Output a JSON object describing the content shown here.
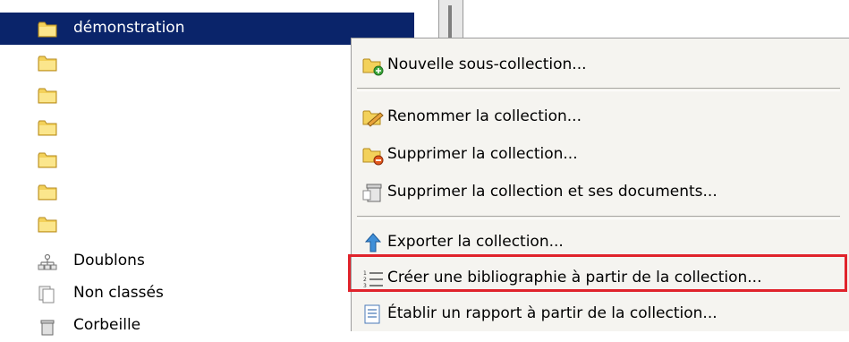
{
  "tree": {
    "selected_label": "démonstration",
    "items": [
      {
        "label": "",
        "icon": "folder-icon"
      },
      {
        "label": "",
        "icon": "folder-icon"
      },
      {
        "label": "",
        "icon": "folder-icon"
      },
      {
        "label": "",
        "icon": "folder-icon"
      },
      {
        "label": "",
        "icon": "folder-icon"
      },
      {
        "label": "",
        "icon": "folder-icon"
      }
    ],
    "duplicates_label": "Doublons",
    "unfiled_label": "Non classés",
    "trash_label": "Corbeille"
  },
  "menu": {
    "new_subcollection": "Nouvelle sous-collection...",
    "rename": "Renommer la collection...",
    "delete": "Supprimer la collection...",
    "delete_with_docs": "Supprimer la collection et ses documents...",
    "export": "Exporter la collection...",
    "bibliography": "Créer une bibliographie à partir de la collection...",
    "report": "Établir un rapport à partir de la collection..."
  },
  "colors": {
    "selection": "#0a246a",
    "highlight_box": "#e0232b",
    "folder": "#f3d15a"
  }
}
